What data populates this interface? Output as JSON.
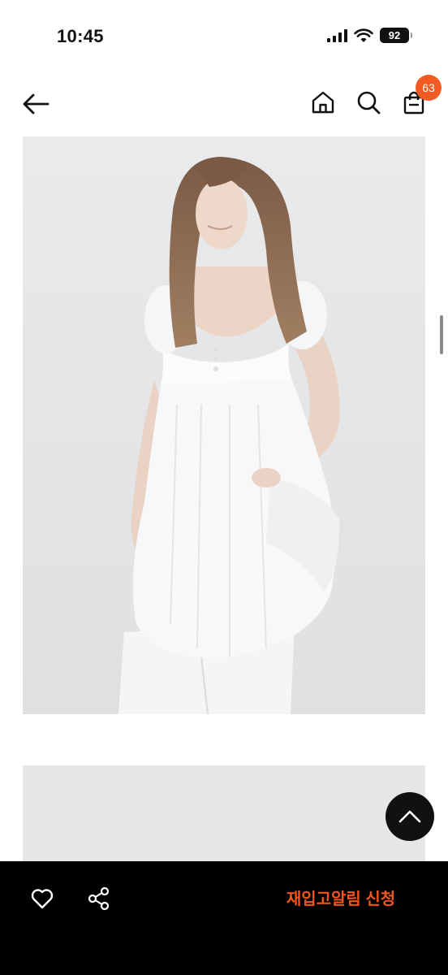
{
  "status_bar": {
    "time": "10:45",
    "battery": "92"
  },
  "header": {
    "back_icon": "arrow-left-icon",
    "home_icon": "home-icon",
    "search_icon": "search-icon",
    "cart_icon": "shopping-bag-icon",
    "cart_count": "63",
    "badge_color": "#f15a22"
  },
  "product": {
    "images": [
      "model-white-dress-photo",
      "second-product-photo"
    ]
  },
  "scroll_top": {
    "icon": "chevron-up-icon"
  },
  "bottom_bar": {
    "like_icon": "heart-icon",
    "share_icon": "share-icon",
    "restock_label": "재입고알림 신청",
    "accent_color": "#f1551f"
  }
}
